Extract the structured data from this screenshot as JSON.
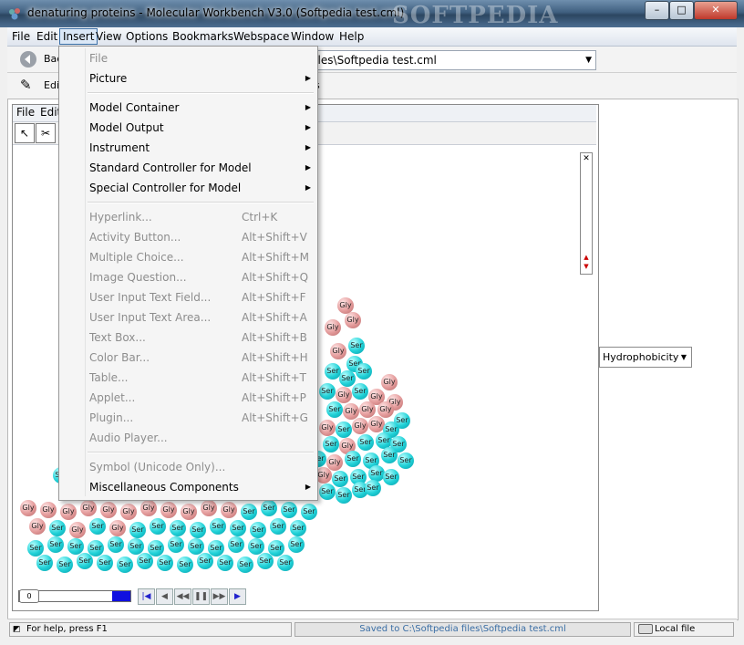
{
  "window": {
    "title": "denaturing proteins - Molecular Workbench V3.0 (Softpedia test.cml)",
    "watermark": "SOFTPEDIA",
    "controls": [
      "–",
      "□",
      "✕"
    ]
  },
  "menubar": [
    "File",
    "Edit",
    "Insert",
    "View",
    "Options",
    "Bookmarks",
    "Webspace",
    "Window",
    "Help"
  ],
  "toolbar": {
    "back_label": "Back",
    "edit_label": "Edit",
    "address": "files\\Softpedia test.cml",
    "extra_s": "s"
  },
  "inner_menu": [
    "File",
    "Edit"
  ],
  "insert_menu": {
    "items": [
      {
        "label": "File",
        "shortcut": "",
        "submenu": false,
        "enabled": false
      },
      {
        "label": "Picture",
        "shortcut": "",
        "submenu": true,
        "enabled": true
      },
      {
        "sep": true
      },
      {
        "label": "Model Container",
        "shortcut": "",
        "submenu": true,
        "enabled": true
      },
      {
        "label": "Model Output",
        "shortcut": "",
        "submenu": true,
        "enabled": true
      },
      {
        "label": "Instrument",
        "shortcut": "",
        "submenu": true,
        "enabled": true
      },
      {
        "label": "Standard Controller for Model",
        "shortcut": "",
        "submenu": true,
        "enabled": true
      },
      {
        "label": "Special Controller for Model",
        "shortcut": "",
        "submenu": true,
        "enabled": true
      },
      {
        "sep": true
      },
      {
        "label": "Hyperlink...",
        "shortcut": "Ctrl+K",
        "submenu": false,
        "enabled": false
      },
      {
        "label": "Activity Button...",
        "shortcut": "Alt+Shift+V",
        "submenu": false,
        "enabled": false
      },
      {
        "label": "Multiple Choice...",
        "shortcut": "Alt+Shift+M",
        "submenu": false,
        "enabled": false
      },
      {
        "label": "Image Question...",
        "shortcut": "Alt+Shift+Q",
        "submenu": false,
        "enabled": false
      },
      {
        "label": "User Input Text Field...",
        "shortcut": "Alt+Shift+F",
        "submenu": false,
        "enabled": false
      },
      {
        "label": "User Input Text Area...",
        "shortcut": "Alt+Shift+A",
        "submenu": false,
        "enabled": false
      },
      {
        "label": "Text Box...",
        "shortcut": "Alt+Shift+B",
        "submenu": false,
        "enabled": false
      },
      {
        "label": "Color Bar...",
        "shortcut": "Alt+Shift+H",
        "submenu": false,
        "enabled": false
      },
      {
        "label": "Table...",
        "shortcut": "Alt+Shift+T",
        "submenu": false,
        "enabled": false
      },
      {
        "label": "Applet...",
        "shortcut": "Alt+Shift+P",
        "submenu": false,
        "enabled": false
      },
      {
        "label": "Plugin...",
        "shortcut": "Alt+Shift+G",
        "submenu": false,
        "enabled": false
      },
      {
        "label": "Audio Player...",
        "shortcut": "",
        "submenu": false,
        "enabled": false
      },
      {
        "sep": true
      },
      {
        "label": "Symbol (Unicode Only)...",
        "shortcut": "",
        "submenu": false,
        "enabled": false
      },
      {
        "label": "Miscellaneous Components",
        "shortcut": "",
        "submenu": true,
        "enabled": true
      }
    ]
  },
  "molecule": {
    "labels": {
      "ser": "Ser",
      "gly": "Gly"
    },
    "colors": {
      "ser": "#1fd0d6",
      "gly": "#e39a9a"
    }
  },
  "property_select": "Hydrophobicity",
  "playback": {
    "frame": "0",
    "buttons": [
      "first-frame-icon",
      "step-back-icon",
      "rewind-icon",
      "pause-icon",
      "fast-forward-icon",
      "play-icon"
    ]
  },
  "status": {
    "help": "For help, press F1",
    "saved": "Saved to C:\\Softpedia files\\Softpedia test.cml",
    "location": "Local file"
  },
  "colors": {
    "accent": "#3a6ea5",
    "progress": "#1010e0"
  }
}
